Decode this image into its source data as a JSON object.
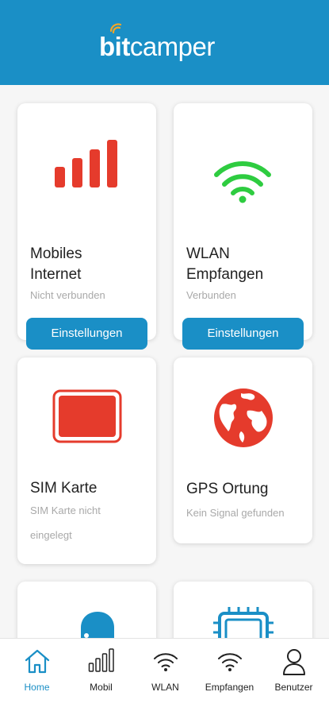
{
  "header": {
    "logo_bit": "bit",
    "logo_camper": "camper"
  },
  "cards": [
    {
      "title_line1": "Mobiles",
      "title_line2": "Internet",
      "status": "Nicht verbunden",
      "button": "Einstellungen",
      "icon": "signal-bars-icon",
      "icon_color": "#e53b2c"
    },
    {
      "title_line1": "WLAN",
      "title_line2": "Empfangen",
      "status": "Verbunden",
      "button": "Einstellungen",
      "icon": "wifi-icon",
      "icon_color": "#2ecc40"
    },
    {
      "title": "SIM Karte",
      "status_line1": "SIM Karte nicht",
      "status_line2": "eingelegt",
      "icon": "sim-card-icon",
      "icon_color": "#e53b2c"
    },
    {
      "title": "GPS Ortung",
      "status": "Kein Signal gefunden",
      "icon": "globe-icon",
      "icon_color": "#e53b2c"
    },
    {
      "icon": "user-bubble-icon",
      "icon_color": "#1a8fc6"
    },
    {
      "icon": "chip-icon",
      "icon_color": "#1a8fc6"
    }
  ],
  "tabs": [
    {
      "label": "Home",
      "icon": "home-icon",
      "active": true
    },
    {
      "label": "Mobil",
      "icon": "signal-bars-icon"
    },
    {
      "label": "WLAN",
      "icon": "wifi-icon"
    },
    {
      "label": "Empfangen",
      "icon": "wifi-icon"
    },
    {
      "label": "Benutzer",
      "icon": "user-icon"
    }
  ],
  "colors": {
    "primary": "#1a8fc6",
    "alert": "#e53b2c",
    "ok": "#2ecc40"
  }
}
